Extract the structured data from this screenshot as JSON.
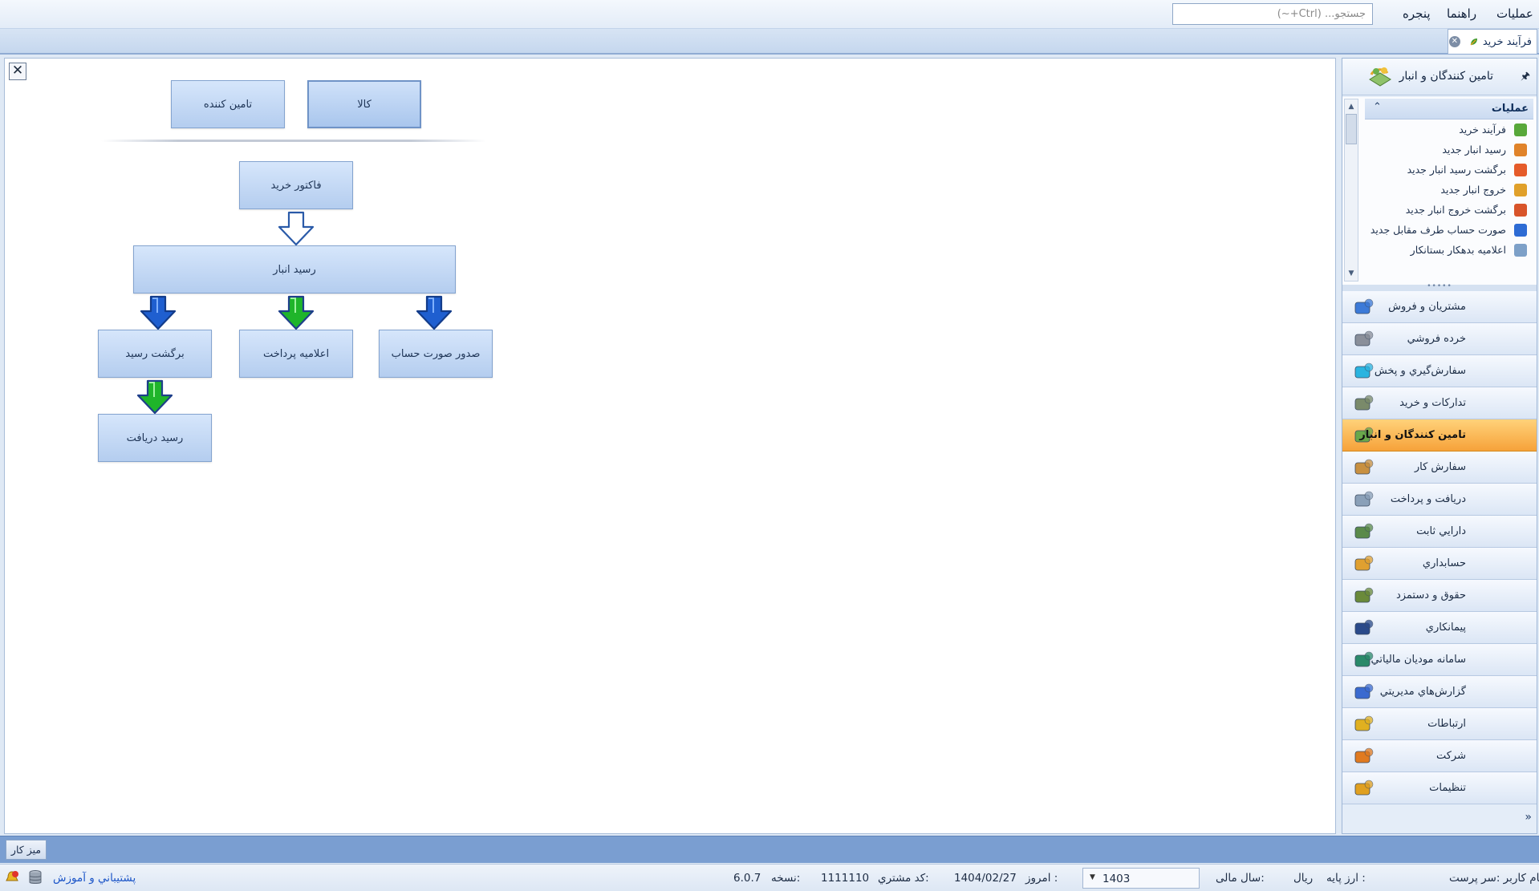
{
  "menubar": {
    "items": [
      "عملیات",
      "راهنما",
      "پنجره"
    ],
    "search_placeholder": "جستجو... (Ctrl+~)"
  },
  "tabs": [
    {
      "label": "فرآیند خرید"
    }
  ],
  "canvas": {
    "close_glyph": "✕",
    "top_boxes": [
      {
        "label": "تامین کننده",
        "selected": false
      },
      {
        "label": "کالا",
        "selected": true
      }
    ],
    "flow": {
      "invoice": "فاکتور خرید",
      "receipt": "رسید انبار",
      "return": "برگشت رسید",
      "payment": "اعلامیه پرداخت",
      "bill": "صدور صورت حساب",
      "collection": "رسید دریافت"
    },
    "arrow_colors": {
      "white": "#ffffff",
      "blue": "#1f5fd0",
      "green": "#1fb52a"
    }
  },
  "nav": {
    "header_title": "تامین کنندگان و انبار",
    "pin_glyph": "🖈",
    "ops_title": "عملیات",
    "ops_collapse_glyph": "⌃",
    "ops": [
      {
        "label": "فرآیند خرید",
        "icon": "process-icon",
        "color": "#58a83a"
      },
      {
        "label": "رسید انبار جدید",
        "icon": "receipt-icon",
        "color": "#e0832a"
      },
      {
        "label": "برگشت رسید انبار جدید",
        "icon": "return-receipt-icon",
        "color": "#e55b2a"
      },
      {
        "label": "خروج انبار جدید",
        "icon": "warehouse-exit-icon",
        "color": "#e0a02a"
      },
      {
        "label": "برگشت خروج انبار جدید",
        "icon": "return-exit-icon",
        "color": "#d8542a"
      },
      {
        "label": "صورت حساب طرف مقابل جدید",
        "icon": "statement-icon",
        "color": "#2d6bd4"
      },
      {
        "label": "اعلامیه بدهکار بستانکار",
        "icon": "debit-credit-icon",
        "color": "#7da0c8"
      }
    ],
    "modules": [
      {
        "label": "مشتریان و فروش",
        "icon": "sales-icon",
        "color": "#3c7ad8",
        "active": false
      },
      {
        "label": "خرده فروشي",
        "icon": "retail-icon",
        "color": "#8a8f9a",
        "active": false
      },
      {
        "label": "سفارش‌گيري و پخش",
        "icon": "distribution-icon",
        "color": "#2ab4e0",
        "active": false
      },
      {
        "label": "تدارکات و خريد",
        "icon": "procurement-icon",
        "color": "#7a8a6a",
        "active": false
      },
      {
        "label": "تامين کنندگان و انبار",
        "icon": "suppliers-icon",
        "color": "#6aa84a",
        "active": true
      },
      {
        "label": "سفارش کار",
        "icon": "work-order-icon",
        "color": "#c89040",
        "active": false
      },
      {
        "label": "دريافت و پرداخت",
        "icon": "payment-icon",
        "color": "#8aa0b8",
        "active": false
      },
      {
        "label": "دارايي ثابت",
        "icon": "fixed-assets-icon",
        "color": "#5a8a4a",
        "active": false
      },
      {
        "label": "حسابداري",
        "icon": "accounting-icon",
        "color": "#e0a030",
        "active": false
      },
      {
        "label": "حقوق و دستمزد",
        "icon": "payroll-icon",
        "color": "#6a8a3a",
        "active": false
      },
      {
        "label": "پيمانکاري",
        "icon": "contracting-icon",
        "color": "#2a4a8a",
        "active": false
      },
      {
        "label": "سامانه موديان مالياتي",
        "icon": "tax-system-icon",
        "color": "#2a8a6a",
        "active": false
      },
      {
        "label": "گزارش‌هاي مديريتي",
        "icon": "reports-icon",
        "color": "#3a6ad0",
        "active": false
      },
      {
        "label": "ارتباطات",
        "icon": "communications-icon",
        "color": "#e0b020",
        "active": false
      },
      {
        "label": "شرکت",
        "icon": "company-icon",
        "color": "#e07a20",
        "active": false
      },
      {
        "label": "تنظيمات",
        "icon": "settings-icon",
        "color": "#e0a020",
        "active": false
      }
    ],
    "more_glyph": "»"
  },
  "taskbar": {
    "desk_label": "ميز کار"
  },
  "status": {
    "user": "نام کاربر :سر پرست",
    "base_currency_label": "ارز پایه :",
    "base_currency": "ريال",
    "fiscal_year_label": "سال مالی:",
    "fiscal_year": "1403",
    "today_label": "امروز :",
    "today": "1404/02/27",
    "customer_code_label": "کد مشتري:",
    "customer_code": "1111110",
    "version_label": "نسخه:",
    "version": "6.0.7",
    "support_link": "پشتيباني و آموزش"
  }
}
